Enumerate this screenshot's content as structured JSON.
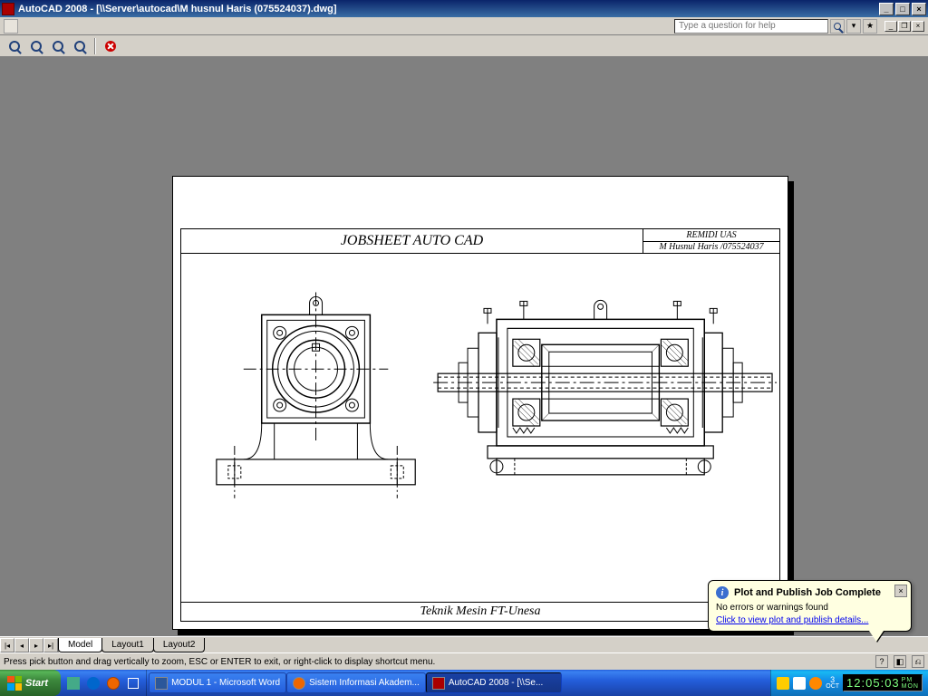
{
  "titlebar": {
    "app": "AutoCAD 2008 - [\\\\Server\\autocad\\M husnul Haris (075524037).dwg]"
  },
  "help": {
    "placeholder": "Type a question for help"
  },
  "tabs": {
    "model": "Model",
    "layout1": "Layout1",
    "layout2": "Layout2"
  },
  "status": {
    "hint": "Press pick button and drag vertically to zoom, ESC or ENTER to exit, or right-click to display shortcut menu."
  },
  "balloon": {
    "title": "Plot and Publish Job Complete",
    "line1": "No errors or warnings found",
    "link": "Click to view plot and publish details..."
  },
  "drawing": {
    "title": "JOBSHEET AUTO CAD",
    "side_top": "REMIDI UAS",
    "side_bottom": "M Husnul Haris /075524037",
    "footer": "Teknik Mesin  FT-Unesa"
  },
  "taskbar": {
    "start": "Start",
    "tasks": [
      "MODUL 1 - Microsoft Word",
      "Sistem Informasi Akadem...",
      "AutoCAD 2008 - [\\\\Se..."
    ],
    "clock": {
      "time": "12:05:03",
      "ampm_top": "PM",
      "ampm_bot": "MON",
      "date": "3",
      "month": "OCT"
    }
  }
}
